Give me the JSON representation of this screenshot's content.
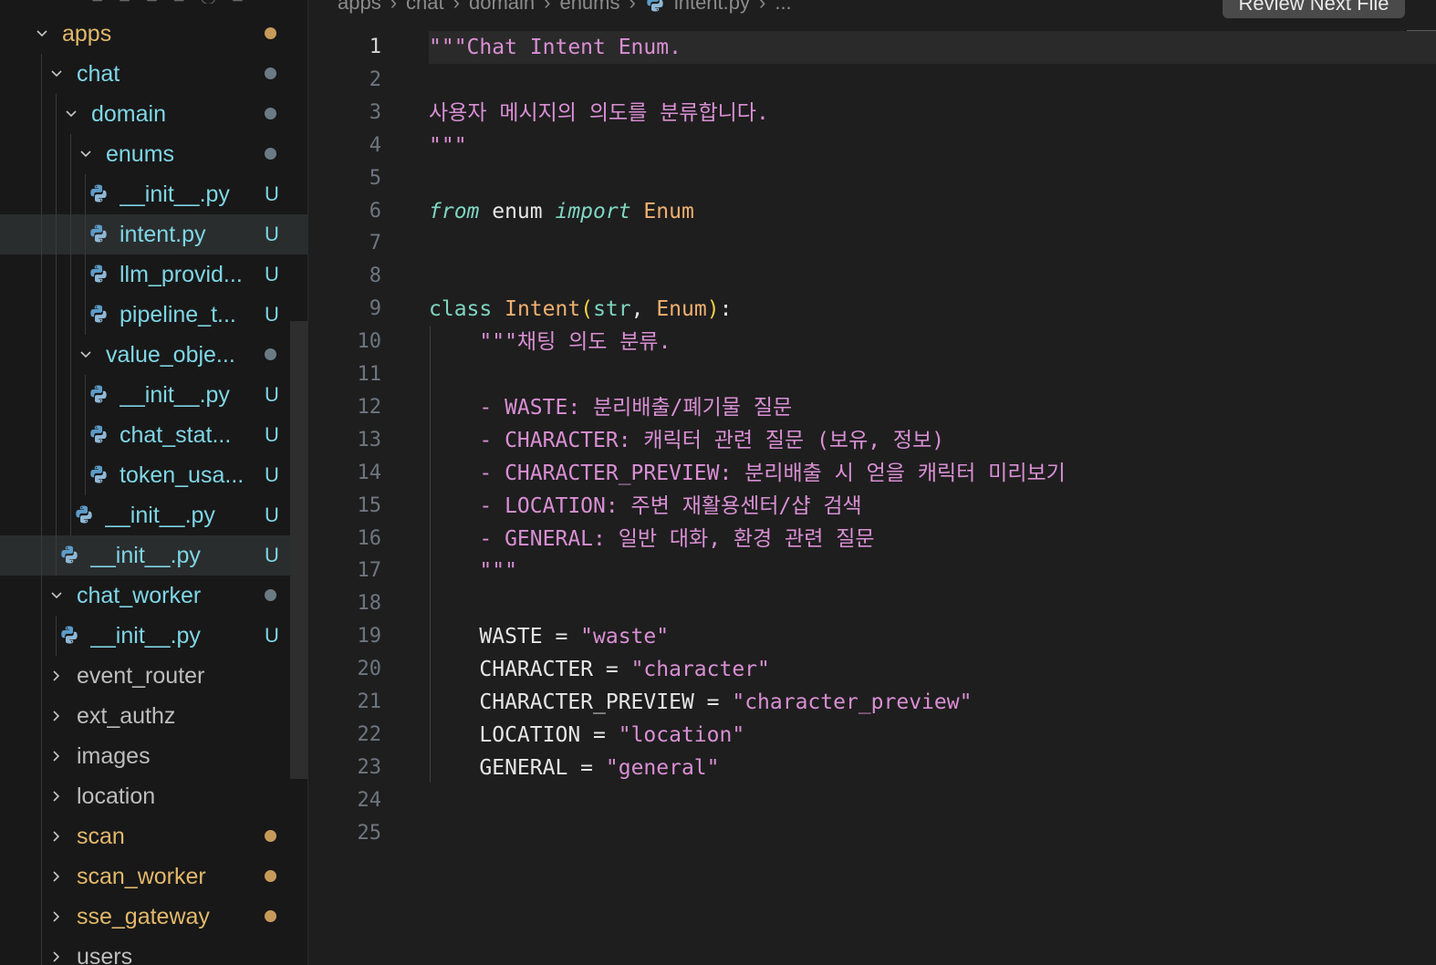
{
  "sidebar": {
    "peek_text": "⊟ ⊞ ⊡ ⊟ ◯ ⊟",
    "tree": [
      {
        "label": "apps",
        "type": "folder",
        "expanded": true,
        "indent": 0,
        "status": "dot",
        "color": "#e2b86b"
      },
      {
        "label": "chat",
        "type": "folder",
        "expanded": true,
        "indent": 1,
        "status": "dot",
        "color": "#7fd6e6"
      },
      {
        "label": "domain",
        "type": "folder",
        "expanded": true,
        "indent": 2,
        "status": "dot",
        "color": "#7fd6e6"
      },
      {
        "label": "enums",
        "type": "folder",
        "expanded": true,
        "indent": 3,
        "status": "dot",
        "color": "#7fd6e6"
      },
      {
        "label": "__init__.py",
        "type": "file",
        "indent": 4,
        "status": "U",
        "color": "#7fd6e6"
      },
      {
        "label": "intent.py",
        "type": "file",
        "indent": 4,
        "status": "U",
        "color": "#7fd6e6",
        "selected": true
      },
      {
        "label": "llm_provid...",
        "type": "file",
        "indent": 4,
        "status": "U",
        "color": "#7fd6e6"
      },
      {
        "label": "pipeline_t...",
        "type": "file",
        "indent": 4,
        "status": "U",
        "color": "#7fd6e6"
      },
      {
        "label": "value_obje...",
        "type": "folder",
        "expanded": true,
        "indent": 3,
        "status": "dot",
        "color": "#7fd6e6"
      },
      {
        "label": "__init__.py",
        "type": "file",
        "indent": 4,
        "status": "U",
        "color": "#7fd6e6"
      },
      {
        "label": "chat_stat...",
        "type": "file",
        "indent": 4,
        "status": "U",
        "color": "#7fd6e6"
      },
      {
        "label": "token_usa...",
        "type": "file",
        "indent": 4,
        "status": "U",
        "color": "#7fd6e6"
      },
      {
        "label": "__init__.py",
        "type": "file",
        "indent": 3,
        "status": "U",
        "color": "#7fd6e6"
      },
      {
        "label": "__init__.py",
        "type": "file",
        "indent": 2,
        "status": "U",
        "color": "#7fd6e6",
        "selected": true
      },
      {
        "label": "chat_worker",
        "type": "folder",
        "expanded": true,
        "indent": 1,
        "status": "dot",
        "color": "#7fd6e6"
      },
      {
        "label": "__init__.py",
        "type": "file",
        "indent": 2,
        "status": "U",
        "color": "#7fd6e6"
      },
      {
        "label": "event_router",
        "type": "folder",
        "expanded": false,
        "indent": 1,
        "status": "",
        "color": "#bdbdbd"
      },
      {
        "label": "ext_authz",
        "type": "folder",
        "expanded": false,
        "indent": 1,
        "status": "",
        "color": "#bdbdbd"
      },
      {
        "label": "images",
        "type": "folder",
        "expanded": false,
        "indent": 1,
        "status": "",
        "color": "#bdbdbd"
      },
      {
        "label": "location",
        "type": "folder",
        "expanded": false,
        "indent": 1,
        "status": "",
        "color": "#bdbdbd"
      },
      {
        "label": "scan",
        "type": "folder",
        "expanded": false,
        "indent": 1,
        "status": "dot",
        "color": "#e2b86b"
      },
      {
        "label": "scan_worker",
        "type": "folder",
        "expanded": false,
        "indent": 1,
        "status": "dot",
        "color": "#e2b86b"
      },
      {
        "label": "sse_gateway",
        "type": "folder",
        "expanded": false,
        "indent": 1,
        "status": "dot",
        "color": "#e2b86b"
      },
      {
        "label": "users",
        "type": "folder",
        "expanded": false,
        "indent": 1,
        "status": "",
        "color": "#bdbdbd"
      }
    ]
  },
  "breadcrumb": [
    "apps",
    "chat",
    "domain",
    "enums",
    "intent.py",
    "..."
  ],
  "review_button": "Review Next File",
  "editor": {
    "active_line": 1,
    "lines": [
      [
        [
          "tk-doc",
          "\"\"\"Chat Intent Enum."
        ]
      ],
      [],
      [
        [
          "tk-doc",
          "사용자 메시지의 의도를 분류합니다."
        ]
      ],
      [
        [
          "tk-doc",
          "\"\"\""
        ]
      ],
      [],
      [
        [
          "tk-kw",
          "from"
        ],
        [
          "tk-name",
          " enum "
        ],
        [
          "tk-kw",
          "import"
        ],
        [
          "tk-type",
          " Enum"
        ]
      ],
      [],
      [],
      [
        [
          "tk-kw2",
          "class"
        ],
        [
          "tk-name",
          " "
        ],
        [
          "tk-type",
          "Intent"
        ],
        [
          "tk-paren",
          "("
        ],
        [
          "tk-builtin",
          "str"
        ],
        [
          "tk-punc",
          ", "
        ],
        [
          "tk-type",
          "Enum"
        ],
        [
          "tk-paren",
          ")"
        ],
        [
          "tk-punc",
          ":"
        ]
      ],
      [
        [
          "tk-doc",
          "    \"\"\"채팅 의도 분류."
        ]
      ],
      [],
      [
        [
          "tk-doc",
          "    - WASTE: 분리배출/폐기물 질문"
        ]
      ],
      [
        [
          "tk-doc",
          "    - CHARACTER: 캐릭터 관련 질문 (보유, 정보)"
        ]
      ],
      [
        [
          "tk-doc",
          "    - CHARACTER_PREVIEW: 분리배출 시 얻을 캐릭터 미리보기"
        ]
      ],
      [
        [
          "tk-doc",
          "    - LOCATION: 주변 재활용센터/샵 검색"
        ]
      ],
      [
        [
          "tk-doc",
          "    - GENERAL: 일반 대화, 환경 관련 질문"
        ]
      ],
      [
        [
          "tk-doc",
          "    \"\"\""
        ]
      ],
      [],
      [
        [
          "tk-name",
          "    WASTE = "
        ],
        [
          "tk-str",
          "\"waste\""
        ]
      ],
      [
        [
          "tk-name",
          "    CHARACTER = "
        ],
        [
          "tk-str",
          "\"character\""
        ]
      ],
      [
        [
          "tk-name",
          "    CHARACTER_PREVIEW = "
        ],
        [
          "tk-str",
          "\"character_preview\""
        ]
      ],
      [
        [
          "tk-name",
          "    LOCATION = "
        ],
        [
          "tk-str",
          "\"location\""
        ]
      ],
      [
        [
          "tk-name",
          "    GENERAL = "
        ],
        [
          "tk-str",
          "\"general\""
        ]
      ],
      [],
      []
    ]
  }
}
